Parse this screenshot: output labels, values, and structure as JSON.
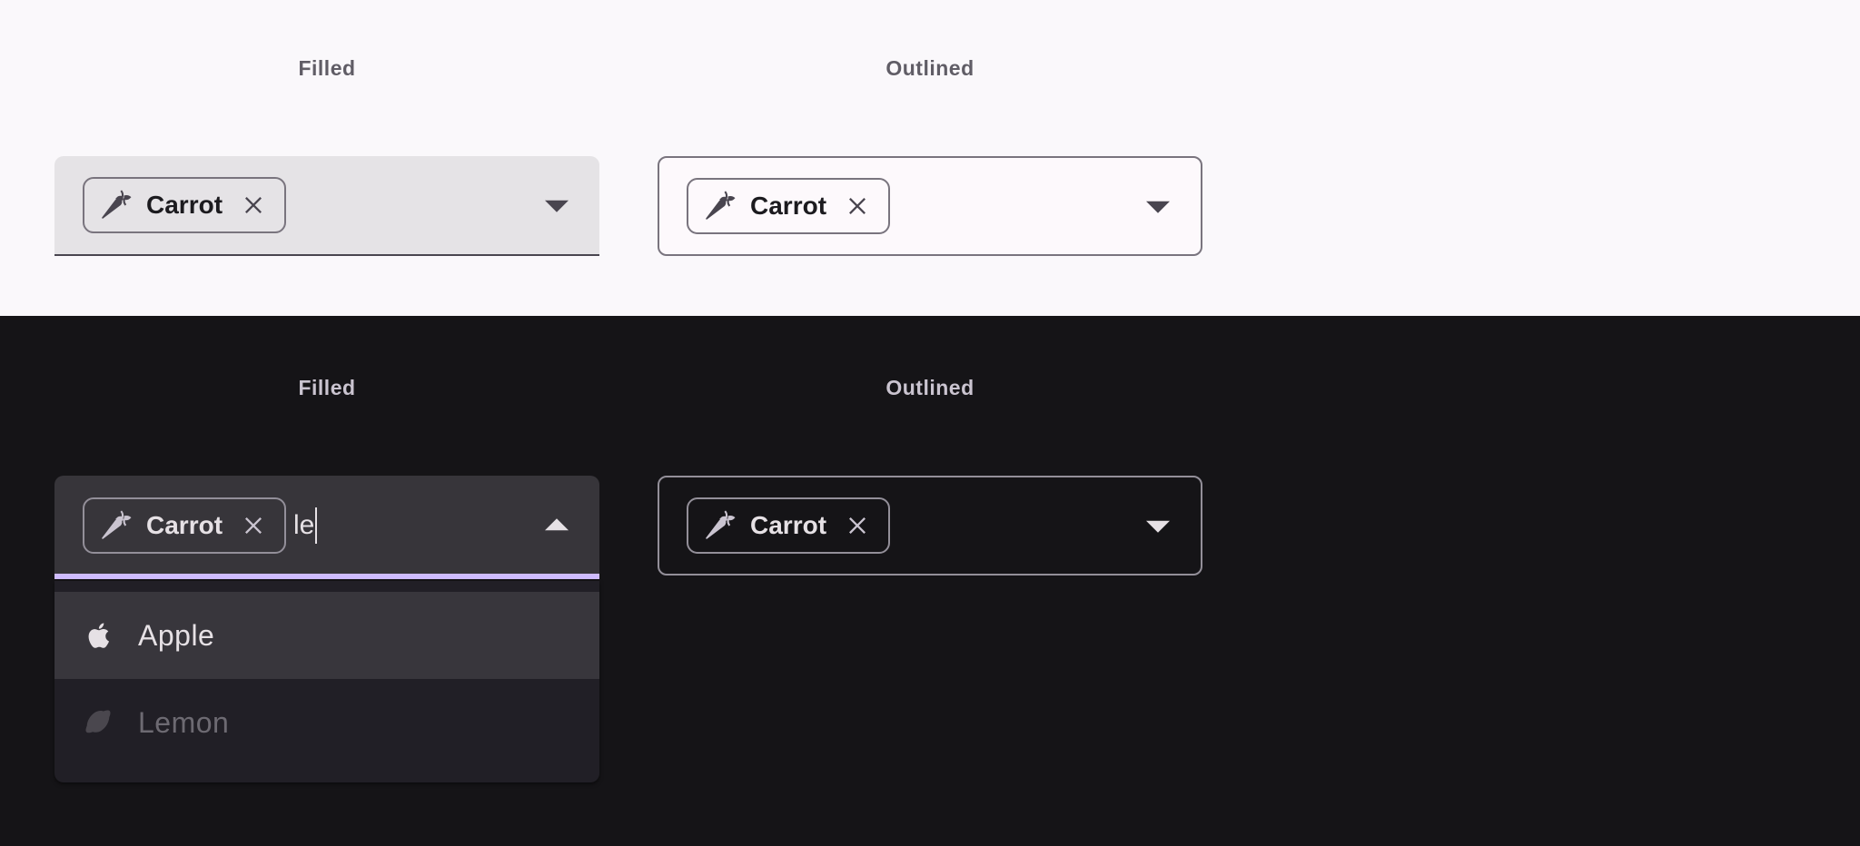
{
  "light_section": {
    "filled": {
      "heading": "Filled",
      "chip_label": "Carrot"
    },
    "outlined": {
      "heading": "Outlined",
      "chip_label": "Carrot"
    }
  },
  "dark_section": {
    "filled": {
      "heading": "Filled",
      "chip_label": "Carrot",
      "input_value": "le",
      "menu": {
        "items": [
          {
            "label": "Apple",
            "icon": "apple-icon",
            "state": "highlighted"
          },
          {
            "label": "Lemon",
            "icon": "lemon-icon",
            "state": "disabled"
          }
        ]
      }
    },
    "outlined": {
      "heading": "Outlined",
      "chip_label": "Carrot"
    }
  },
  "colors": {
    "light_background": "#faf8fb",
    "dark_background": "#151417",
    "focus_indicator": "#cfbcff",
    "filled_light_container": "#e5e3e6",
    "filled_dark_container": "#37353a",
    "menu_container_dark": "#211f26"
  }
}
